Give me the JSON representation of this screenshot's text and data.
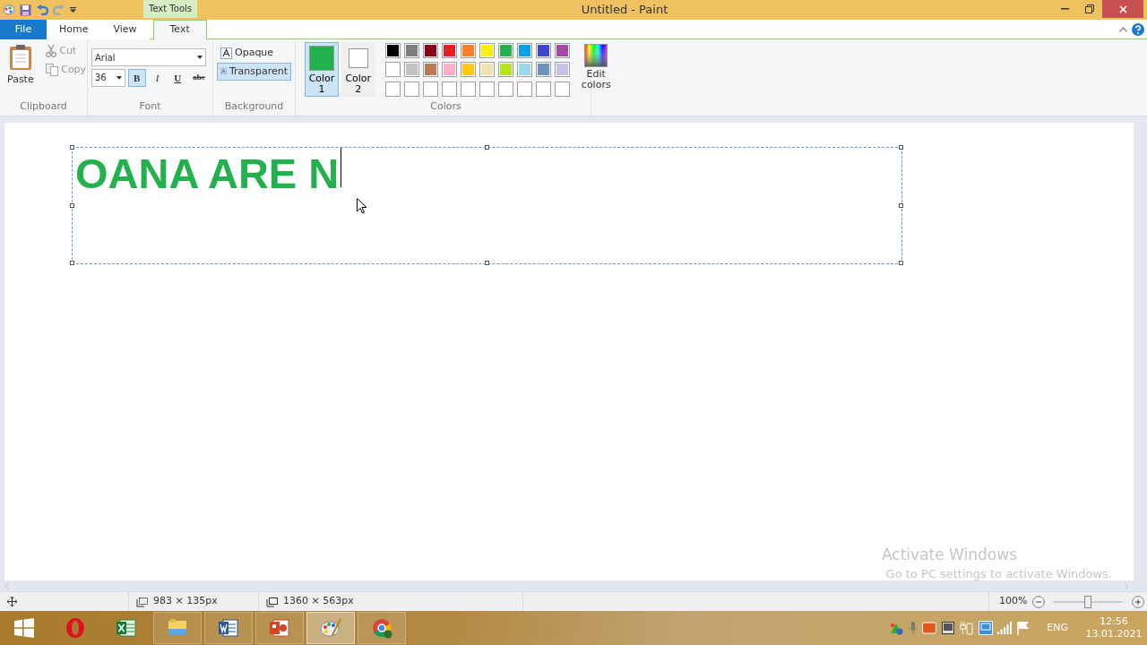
{
  "title_bar": {
    "context_tab": "Text Tools",
    "title": "Untitled - Paint"
  },
  "tabs": [
    {
      "label": "File",
      "kind": "file",
      "selected": false
    },
    {
      "label": "Home",
      "kind": "tab",
      "selected": false
    },
    {
      "label": "View",
      "kind": "tab",
      "selected": false
    },
    {
      "label": "Text",
      "kind": "tab",
      "selected": true
    }
  ],
  "clipboard": {
    "group": "Clipboard",
    "paste": "Paste",
    "items": [
      {
        "label": "Cut",
        "kind": "cut",
        "disabled": true
      },
      {
        "label": "Copy",
        "kind": "copy",
        "disabled": true
      }
    ]
  },
  "font": {
    "group": "Font",
    "family": "Arial",
    "size": "36",
    "styles": [
      {
        "label": "B",
        "kind": "bold",
        "selected": true
      },
      {
        "label": "I",
        "kind": "italic",
        "selected": false
      },
      {
        "label": "U",
        "kind": "underline",
        "selected": false
      },
      {
        "label": "abc",
        "kind": "strike",
        "selected": false
      }
    ]
  },
  "background": {
    "group": "Background",
    "options": [
      {
        "label": "Opaque",
        "selected": false
      },
      {
        "label": "Transparent",
        "selected": true
      }
    ]
  },
  "colors": {
    "group": "Colors",
    "slots": [
      {
        "label": "Color",
        "number": "1",
        "color": "#22b14c",
        "selected": true
      },
      {
        "label": "Color",
        "number": "2",
        "color": "#ffffff",
        "selected": false
      }
    ],
    "palette": [
      {
        "color": "#000000"
      },
      {
        "color": "#7f7f7f"
      },
      {
        "color": "#880015"
      },
      {
        "color": "#ed1c24"
      },
      {
        "color": "#ff7f27"
      },
      {
        "color": "#fff200"
      },
      {
        "color": "#22b14c"
      },
      {
        "color": "#00a2e8"
      },
      {
        "color": "#3f48cc"
      },
      {
        "color": "#a349a4"
      },
      {
        "color": "#ffffff"
      },
      {
        "color": "#c3c3c3"
      },
      {
        "color": "#b97a57"
      },
      {
        "color": "#ffaec9"
      },
      {
        "color": "#ffc90e"
      },
      {
        "color": "#efe4b0"
      },
      {
        "color": "#b5e61d"
      },
      {
        "color": "#99d9ea"
      },
      {
        "color": "#7092be"
      },
      {
        "color": "#c8bfe7"
      }
    ],
    "edit": "Edit colors"
  },
  "canvas": {
    "text": "OANA ARE N"
  },
  "watermark": {
    "title": "Activate Windows",
    "subtitle": "Go to PC settings to activate Windows."
  },
  "status_bar": {
    "selection_size": "983 × 135px",
    "canvas_size": "1360 × 563px",
    "zoom": "100%",
    "level": 0.5
  },
  "taskbar": {
    "apps": [
      {
        "kind": "opera",
        "selected": false
      },
      {
        "kind": "excel",
        "selected": false
      },
      {
        "kind": "explorer",
        "selected": false
      },
      {
        "kind": "word",
        "selected": false
      },
      {
        "kind": "powerpoint",
        "selected": false
      },
      {
        "kind": "paint",
        "selected": true
      },
      {
        "kind": "chrome",
        "selected": false
      }
    ],
    "language": "ENG",
    "time": "12:56",
    "date": "13.01.2021"
  }
}
